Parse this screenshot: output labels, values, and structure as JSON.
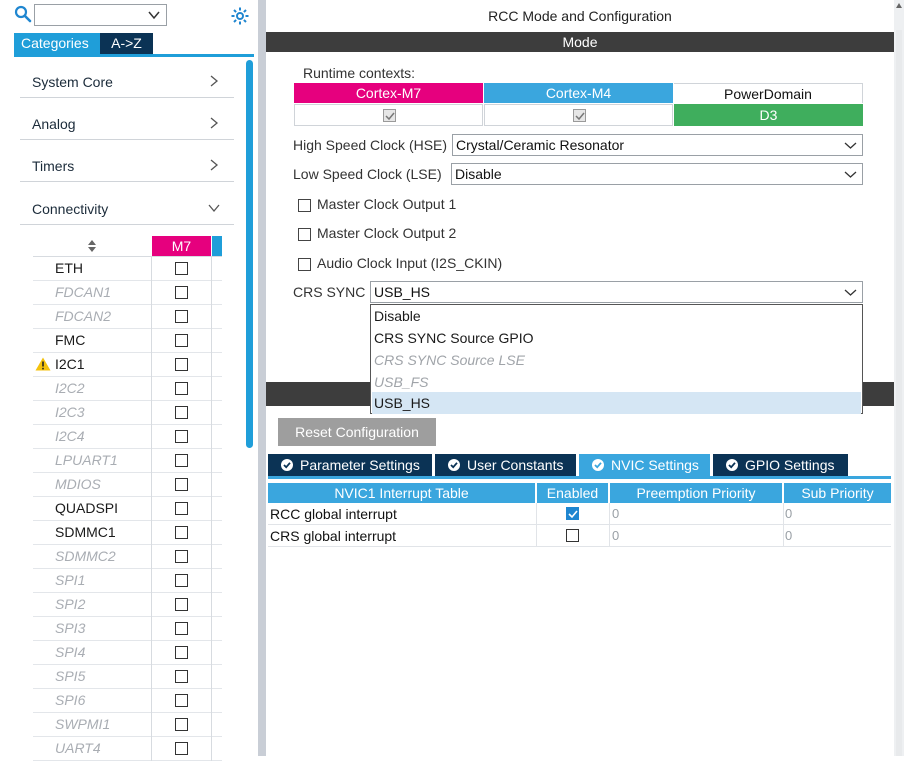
{
  "left": {
    "search": {
      "value": ""
    },
    "tabs": {
      "categories": "Categories",
      "atoz": "A->Z"
    },
    "categories": [
      {
        "label": "System Core",
        "state": "collapsed"
      },
      {
        "label": "Analog",
        "state": "collapsed"
      },
      {
        "label": "Timers",
        "state": "collapsed"
      },
      {
        "label": "Connectivity",
        "state": "expanded"
      }
    ],
    "connectivity": {
      "column_header": "M7",
      "items": [
        {
          "name": "ETH",
          "disabled": false,
          "warning": false,
          "checked": false
        },
        {
          "name": "FDCAN1",
          "disabled": true,
          "warning": false,
          "checked": false
        },
        {
          "name": "FDCAN2",
          "disabled": true,
          "warning": false,
          "checked": false
        },
        {
          "name": "FMC",
          "disabled": false,
          "warning": false,
          "checked": false
        },
        {
          "name": "I2C1",
          "disabled": false,
          "warning": true,
          "checked": false
        },
        {
          "name": "I2C2",
          "disabled": true,
          "warning": false,
          "checked": false
        },
        {
          "name": "I2C3",
          "disabled": true,
          "warning": false,
          "checked": false
        },
        {
          "name": "I2C4",
          "disabled": true,
          "warning": false,
          "checked": false
        },
        {
          "name": "LPUART1",
          "disabled": true,
          "warning": false,
          "checked": false
        },
        {
          "name": "MDIOS",
          "disabled": true,
          "warning": false,
          "checked": false
        },
        {
          "name": "QUADSPI",
          "disabled": false,
          "warning": false,
          "checked": false
        },
        {
          "name": "SDMMC1",
          "disabled": false,
          "warning": false,
          "checked": false
        },
        {
          "name": "SDMMC2",
          "disabled": true,
          "warning": false,
          "checked": false
        },
        {
          "name": "SPI1",
          "disabled": true,
          "warning": false,
          "checked": false
        },
        {
          "name": "SPI2",
          "disabled": true,
          "warning": false,
          "checked": false
        },
        {
          "name": "SPI3",
          "disabled": true,
          "warning": false,
          "checked": false
        },
        {
          "name": "SPI4",
          "disabled": true,
          "warning": false,
          "checked": false
        },
        {
          "name": "SPI5",
          "disabled": true,
          "warning": false,
          "checked": false
        },
        {
          "name": "SPI6",
          "disabled": true,
          "warning": false,
          "checked": false
        },
        {
          "name": "SWPMI1",
          "disabled": true,
          "warning": false,
          "checked": false
        },
        {
          "name": "UART4",
          "disabled": true,
          "warning": false,
          "checked": false
        }
      ]
    }
  },
  "right": {
    "title": "RCC Mode and Configuration",
    "mode_bar": "Mode",
    "runtime_label": "Runtime contexts:",
    "contexts": {
      "m7": "Cortex-M7",
      "m4": "Cortex-M4",
      "power_domain": "PowerDomain",
      "d3": "D3"
    },
    "hse": {
      "label": "High Speed Clock (HSE)",
      "value": "Crystal/Ceramic Resonator"
    },
    "lse": {
      "label": "Low Speed Clock (LSE)",
      "value": "Disable"
    },
    "checkboxes": [
      {
        "label": "Master Clock Output 1",
        "checked": false
      },
      {
        "label": "Master Clock Output 2",
        "checked": false
      },
      {
        "label": "Audio Clock Input (I2S_CKIN)",
        "checked": false
      }
    ],
    "crs_sync": {
      "label": "CRS SYNC",
      "value": "USB_HS",
      "options": [
        {
          "label": "Disable",
          "disabled": false,
          "selected": false
        },
        {
          "label": "CRS SYNC Source GPIO",
          "disabled": false,
          "selected": false
        },
        {
          "label": "CRS SYNC Source LSE",
          "disabled": true,
          "selected": false
        },
        {
          "label": "USB_FS",
          "disabled": true,
          "selected": false
        },
        {
          "label": "USB_HS",
          "disabled": false,
          "selected": true
        }
      ]
    },
    "reset_button": "Reset Configuration",
    "config_tabs": [
      {
        "label": "Parameter Settings",
        "active": false
      },
      {
        "label": "User Constants",
        "active": false
      },
      {
        "label": "NVIC Settings",
        "active": true
      },
      {
        "label": "GPIO Settings",
        "active": false
      }
    ],
    "nvic_table": {
      "headers": [
        "NVIC1 Interrupt Table",
        "Enabled",
        "Preemption Priority",
        "Sub Priority"
      ],
      "rows": [
        {
          "name": "RCC global interrupt",
          "enabled": true,
          "preemption": "0",
          "sub": "0"
        },
        {
          "name": "CRS global interrupt",
          "enabled": false,
          "preemption": "0",
          "sub": "0"
        }
      ]
    }
  }
}
